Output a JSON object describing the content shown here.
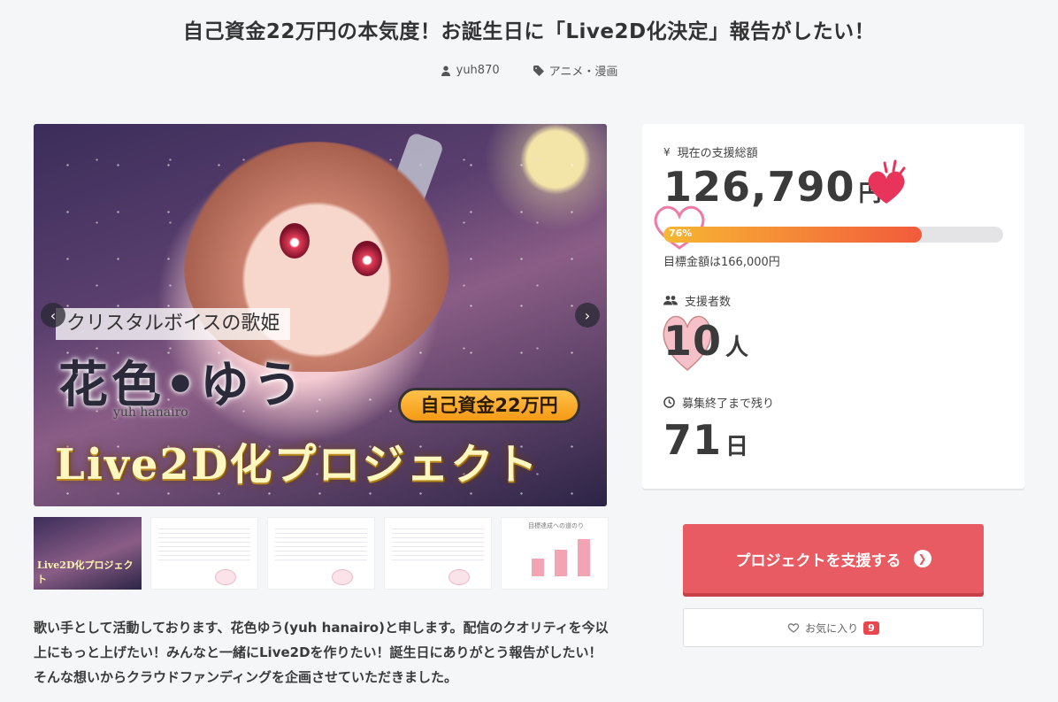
{
  "page": {
    "title": "自己資金22万円の本気度！お誕生日に「Live2D化決定」報告がしたい！",
    "author": "yuh870",
    "category": "アニメ・漫画"
  },
  "hero": {
    "banner_subtitle": "クリスタルボイスの歌姫",
    "name_jp": "花色•ゆう",
    "name_en": "yuh hanairo",
    "pill_text": "自己資金22万円",
    "project_text": "Live2D化プロジェクト",
    "thumb_caption": "Live2D化プロジェクト",
    "chart_thumb_title": "目標達成への道のり"
  },
  "stats": {
    "total_label": "現在の支援総額",
    "total_amount": "126,790",
    "total_unit": "円",
    "progress_percent": 76,
    "progress_label": "76%",
    "goal_text": "目標金額は166,000円",
    "backers_label": "支援者数",
    "backers_count": "10",
    "backers_unit": "人",
    "remaining_label": "募集終了まで残り",
    "remaining_days": "71",
    "remaining_unit": "日"
  },
  "actions": {
    "support_label": "プロジェクトを支援する",
    "favorite_label": "お気に入り",
    "favorite_count": "9"
  },
  "description": "歌い手として活動しております、花色ゆう(yuh hanairo)と申します。配信のクオリティを今以上にもっと上げたい！みんなと一緒にLive2Dを作りたい！誕生日にありがとう報告がしたい！そんな想いからクラウドファンディングを企画させていただきました。",
  "colors": {
    "accent": "#e85b63",
    "progress_start": "#f7b733",
    "progress_end": "#f25a3c",
    "badge": "#e8474f"
  }
}
